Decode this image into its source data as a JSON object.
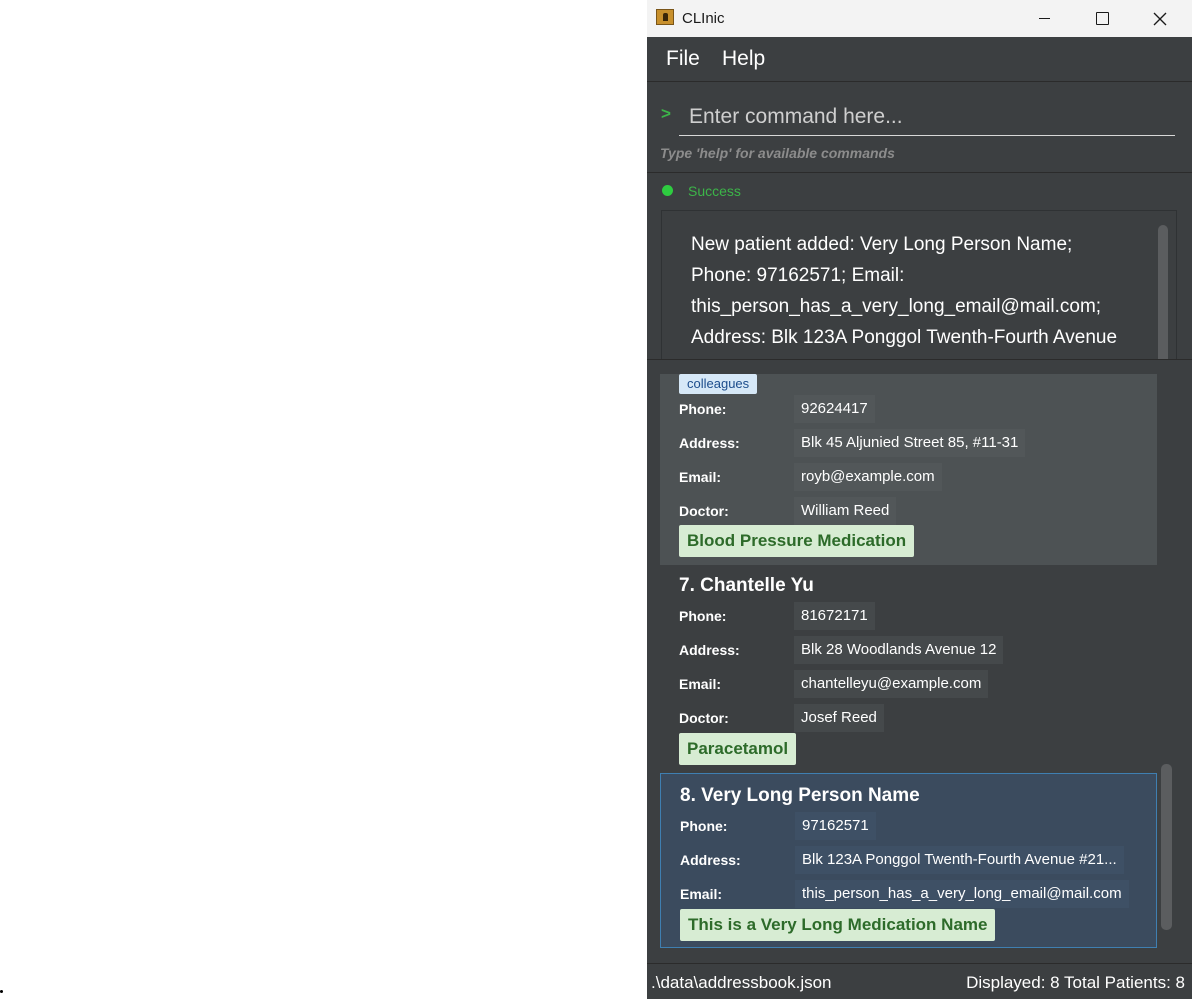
{
  "window": {
    "title": "CLInic"
  },
  "menu": {
    "file": "File",
    "help": "Help"
  },
  "command": {
    "prompt": ">",
    "placeholder": "Enter command here...",
    "hint": "Type 'help' for available commands"
  },
  "result": {
    "status": "Success",
    "status_color": "#2ecc40",
    "message": "New patient added: Very Long Person Name; Phone: 97162571; Email: this_person_has_a_very_long_email@mail.com; Address: Blk 123A Ponggol Twenth-Fourth Avenue"
  },
  "labels": {
    "phone": "Phone:",
    "address": "Address:",
    "email": "Email:",
    "doctor": "Doctor:"
  },
  "patients": [
    {
      "tag": "colleagues",
      "phone": "92624417",
      "address": "Blk 45 Aljunied Street 85, #11-31",
      "email": "royb@example.com",
      "doctor": "William Reed",
      "medication": "Blood Pressure Medication"
    },
    {
      "name": "7. Chantelle Yu",
      "phone": "81672171",
      "address": "Blk 28 Woodlands Avenue 12",
      "email": "chantelleyu@example.com",
      "doctor": "Josef Reed",
      "medication": "Paracetamol"
    },
    {
      "name": "8. Very Long Person Name",
      "phone": "97162571",
      "address": "Blk 123A Ponggol Twenth-Fourth Avenue #21...",
      "email": "this_person_has_a_very_long_email@mail.com",
      "medication": "This is a Very Long Medication Name"
    }
  ],
  "statusbar": {
    "path": ".\\data\\addressbook.json",
    "counts": "Displayed: 8  Total Patients: 8"
  },
  "colors": {
    "background": "#3c3f41",
    "accent_success": "#3cb449",
    "selected_card": "#3b4b5e",
    "medication_tag": "#d7ecd3"
  }
}
